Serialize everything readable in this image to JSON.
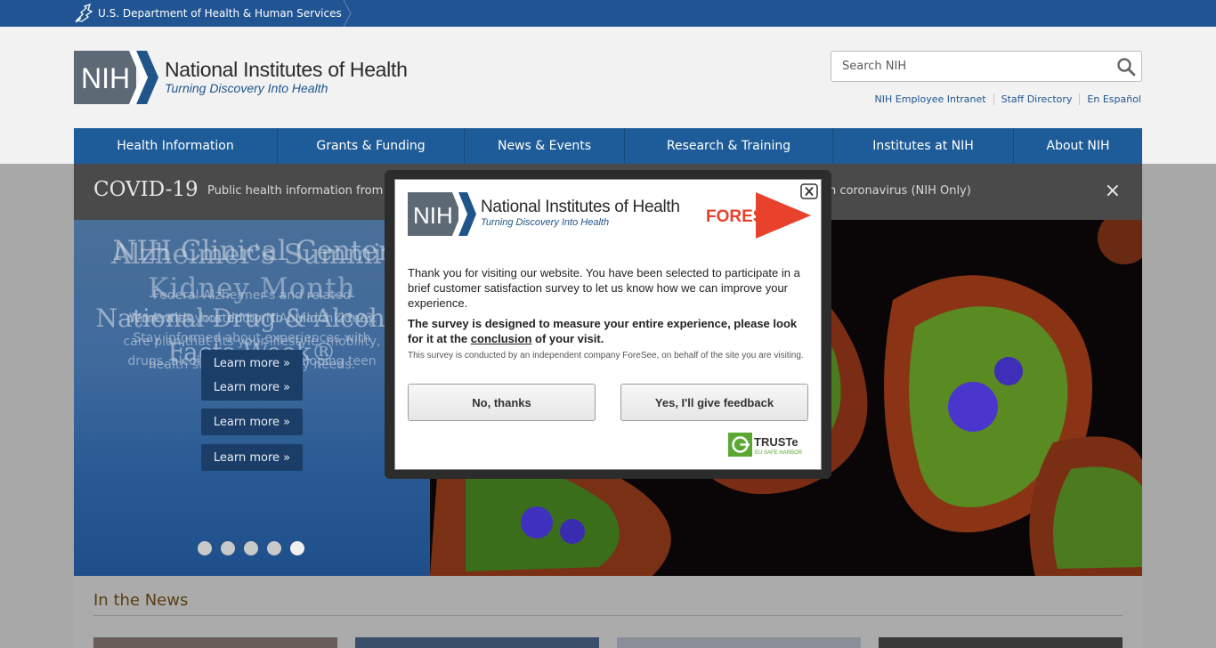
{
  "hhs": {
    "text": "U.S. Department of Health & Human Services"
  },
  "header": {
    "logo_abbrev": "NIH",
    "logo_title": "National Institutes of Health",
    "logo_tagline": "Turning Discovery Into Health",
    "search_placeholder": "Search NIH",
    "util_links": [
      "NIH Employee Intranet",
      "Staff Directory",
      "En Español"
    ]
  },
  "nav": [
    "Health Information",
    "Grants & Funding",
    "News & Events",
    "Research & Training",
    "Institutes at NIH",
    "About NIH"
  ],
  "covid": {
    "title": "COVID-19",
    "text_left": "Public health information from C",
    "text_right": "on coronavirus (NIH Only)",
    "close": "×"
  },
  "hero": {
    "titles": [
      "NIH Clinical Center",
      "Alzheimer's Summit",
      "Kidney Month",
      "National Drug & Alcohol Facts Week®"
    ],
    "descriptions": [
      "Federal Alzheimer's and related dementias, hosted by NIA. March 21-23.",
      "Work with your doctor to build a kidney care plan that fits your lifestyle, mobility, health status, and dietary needs.",
      "Stay informed about experiences with drugs, alcohol, and the developing teen brain."
    ],
    "learn_more": "Learn more »",
    "slide_count": 5,
    "active_slide": 5
  },
  "news": {
    "title": "In the News"
  },
  "survey": {
    "foresee": "FORESEE",
    "para1": "Thank you for visiting our website. You have been selected to participate in a brief customer satisfaction survey to let us know how we can improve your experience.",
    "para2_before": "The survey is designed to measure your entire experience, please look for it at the ",
    "para2_link": "conclusion",
    "para2_after": " of your visit.",
    "para3": "This survey is conducted by an independent company ForeSee, on behalf of the site you are visiting.",
    "decline": "No, thanks",
    "accept": "Yes, I'll give feedback",
    "truste": "TRUSTe",
    "truste_sub": "EU SAFE HARBOR"
  }
}
